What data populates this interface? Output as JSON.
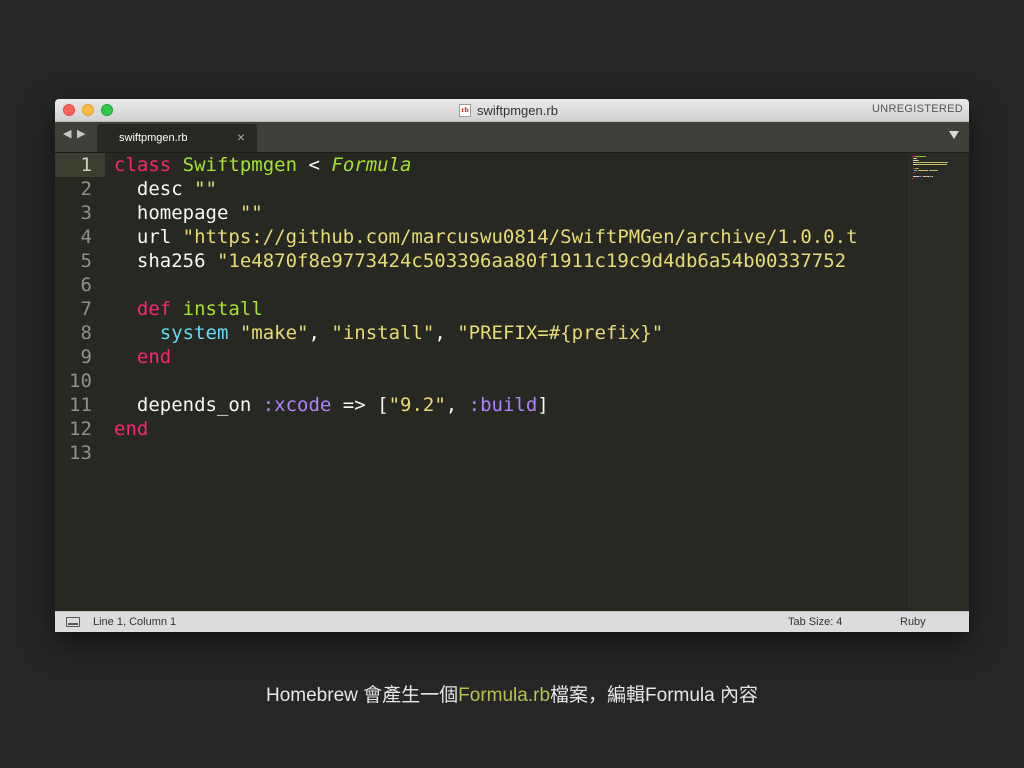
{
  "window": {
    "title": "swiftpmgen.rb",
    "file_icon": "rb",
    "license_status": "UNREGISTERED"
  },
  "tabbar": {
    "nav_back": "◀",
    "nav_forward": "▶",
    "tab_label": "swiftpmgen.rb",
    "tab_close": "×"
  },
  "editor": {
    "line_numbers": [
      "1",
      "2",
      "3",
      "4",
      "5",
      "6",
      "7",
      "8",
      "9",
      "10",
      "11",
      "12",
      "13"
    ],
    "current_line": 1,
    "lines": [
      [
        {
          "t": "class",
          "c": "kw"
        },
        {
          "t": " ",
          "c": ""
        },
        {
          "t": "Swiftpmgen",
          "c": "cls"
        },
        {
          "t": " < ",
          "c": ""
        },
        {
          "t": "Formula",
          "c": "inh"
        }
      ],
      [
        {
          "t": "  desc ",
          "c": ""
        },
        {
          "t": "\"\"",
          "c": "str"
        }
      ],
      [
        {
          "t": "  homepage ",
          "c": ""
        },
        {
          "t": "\"\"",
          "c": "str"
        }
      ],
      [
        {
          "t": "  url ",
          "c": ""
        },
        {
          "t": "\"https://github.com/marcuswu0814/SwiftPMGen/archive/1.0.0.t",
          "c": "str"
        }
      ],
      [
        {
          "t": "  sha256 ",
          "c": ""
        },
        {
          "t": "\"1e4870f8e9773424c503396aa80f1911c19c9d4db6a54b00337752",
          "c": "str"
        }
      ],
      [],
      [
        {
          "t": "  ",
          "c": ""
        },
        {
          "t": "def",
          "c": "kw"
        },
        {
          "t": " ",
          "c": ""
        },
        {
          "t": "install",
          "c": "cls"
        }
      ],
      [
        {
          "t": "    ",
          "c": ""
        },
        {
          "t": "system",
          "c": "fn"
        },
        {
          "t": " ",
          "c": ""
        },
        {
          "t": "\"make\"",
          "c": "str"
        },
        {
          "t": ", ",
          "c": ""
        },
        {
          "t": "\"install\"",
          "c": "str"
        },
        {
          "t": ", ",
          "c": ""
        },
        {
          "t": "\"PREFIX=#{prefix}\"",
          "c": "str"
        }
      ],
      [
        {
          "t": "  ",
          "c": ""
        },
        {
          "t": "end",
          "c": "kw"
        }
      ],
      [],
      [
        {
          "t": "  depends_on ",
          "c": ""
        },
        {
          "t": ":xcode",
          "c": "sym"
        },
        {
          "t": " => [",
          "c": ""
        },
        {
          "t": "\"9.2\"",
          "c": "str"
        },
        {
          "t": ", ",
          "c": ""
        },
        {
          "t": ":build",
          "c": "sym"
        },
        {
          "t": "]",
          "c": ""
        }
      ],
      [
        {
          "t": "end",
          "c": "kw"
        }
      ],
      []
    ]
  },
  "statusbar": {
    "icon": "panel-icon",
    "position": "Line 1, Column 1",
    "tab_size": "Tab Size: 4",
    "syntax": "Ruby"
  },
  "caption": {
    "before": "Homebrew 會產生一個",
    "highlight": "Formula.rb",
    "after": "檔案，編輯Formula 內容"
  },
  "colors": {
    "keyword": "#f92672",
    "class": "#a6e22e",
    "string": "#e6db74",
    "symbol": "#ae81ff",
    "function": "#66d9ef",
    "editor_bg": "#272822",
    "caption_highlight": "#b7c14c"
  }
}
